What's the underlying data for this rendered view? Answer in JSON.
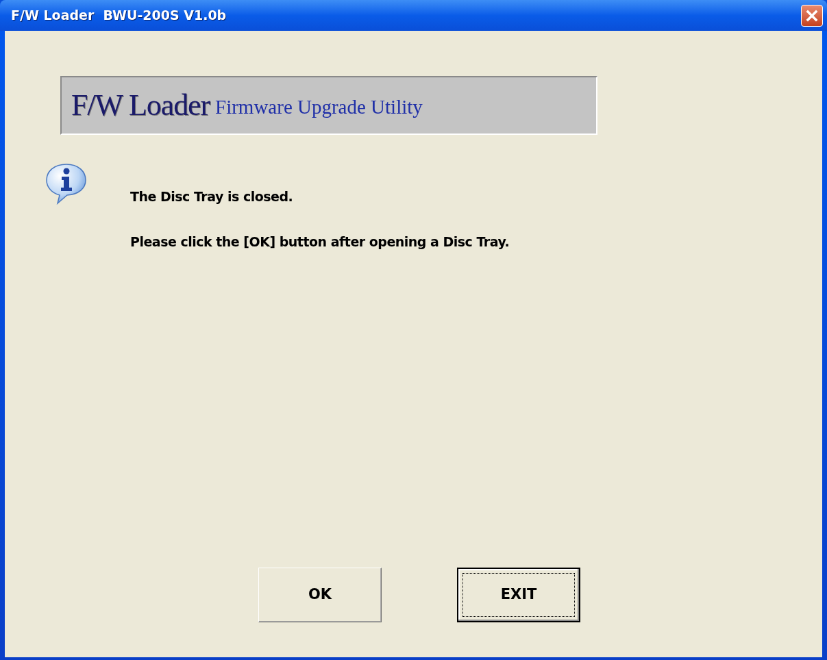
{
  "window": {
    "title": "F/W Loader  BWU-200S V1.0b"
  },
  "banner": {
    "title": "F/W Loader",
    "subtitle": "Firmware Upgrade Utility"
  },
  "messages": [
    "The Disc Tray is closed.",
    "Please click the [OK] button after opening a Disc Tray."
  ],
  "buttons": [
    {
      "label": "OK",
      "focused": false
    },
    {
      "label": "EXIT",
      "focused": true
    }
  ]
}
